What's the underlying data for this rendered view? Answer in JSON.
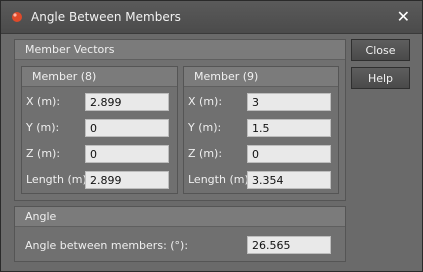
{
  "window": {
    "title": "Angle Between Members"
  },
  "member_vectors": {
    "title": "Member Vectors",
    "member_a": {
      "title": "Member (8)",
      "x_label": "X (m):",
      "x_value": "2.899",
      "y_label": "Y (m):",
      "y_value": "0",
      "z_label": "Z (m):",
      "z_value": "0",
      "length_label": "Length (m):",
      "length_value": "2.899"
    },
    "member_b": {
      "title": "Member (9)",
      "x_label": "X (m):",
      "x_value": "3",
      "y_label": "Y (m):",
      "y_value": "1.5",
      "z_label": "Z (m):",
      "z_value": "0",
      "length_label": "Length (m):",
      "length_value": "3.354"
    }
  },
  "angle": {
    "title": "Angle",
    "label": "Angle between members: (°):",
    "value": "26.565"
  },
  "buttons": {
    "close": "Close",
    "help": "Help"
  },
  "icons": {
    "app": "member-icon",
    "close": "close-icon"
  }
}
